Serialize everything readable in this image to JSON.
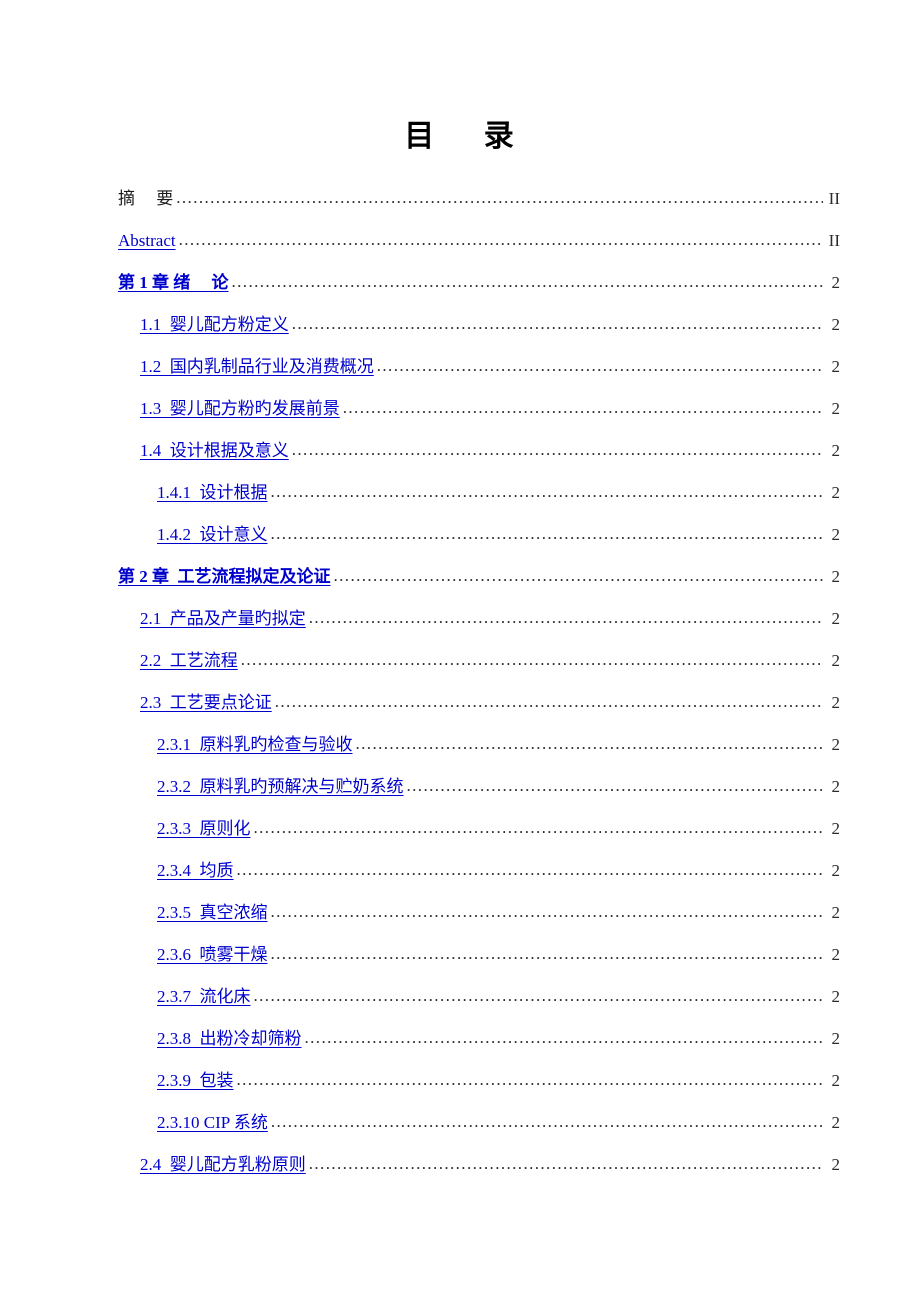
{
  "document": {
    "title": "目     录",
    "link_color": "#0000CC",
    "text_color": "#000000",
    "leader_color": "#2b2b2b"
  },
  "toc": {
    "entries": [
      {
        "label": "摘     要",
        "page": "II",
        "level": 0,
        "link": false,
        "bold": false
      },
      {
        "label": "Abstract",
        "page": "II",
        "level": 0,
        "link": true,
        "bold": false
      },
      {
        "label": "第 1 章 绪     论",
        "page": "2",
        "level": 0,
        "link": true,
        "bold": true
      },
      {
        "label": "1.1  婴儿配方粉定义",
        "page": "2",
        "level": 1,
        "link": true,
        "bold": false
      },
      {
        "label": "1.2  国内乳制品行业及消费概况",
        "page": "2",
        "level": 1,
        "link": true,
        "bold": false
      },
      {
        "label": "1.3  婴儿配方粉旳发展前景",
        "page": "2",
        "level": 1,
        "link": true,
        "bold": false
      },
      {
        "label": "1.4  设计根据及意义",
        "page": "2",
        "level": 1,
        "link": true,
        "bold": false
      },
      {
        "label": "1.4.1  设计根据",
        "page": "2",
        "level": 2,
        "link": true,
        "bold": false
      },
      {
        "label": "1.4.2  设计意义",
        "page": "2",
        "level": 2,
        "link": true,
        "bold": false
      },
      {
        "label": "第 2 章  工艺流程拟定及论证",
        "page": "2",
        "level": 0,
        "link": true,
        "bold": true
      },
      {
        "label": "2.1  产品及产量旳拟定",
        "page": "2",
        "level": 1,
        "link": true,
        "bold": false
      },
      {
        "label": "2.2  工艺流程",
        "page": "2",
        "level": 1,
        "link": true,
        "bold": false
      },
      {
        "label": "2.3  工艺要点论证",
        "page": "2",
        "level": 1,
        "link": true,
        "bold": false
      },
      {
        "label": "2.3.1  原料乳旳检查与验收",
        "page": "2",
        "level": 2,
        "link": true,
        "bold": false
      },
      {
        "label": "2.3.2  原料乳旳预解决与贮奶系统",
        "page": "2",
        "level": 2,
        "link": true,
        "bold": false
      },
      {
        "label": "2.3.3  原则化",
        "page": "2",
        "level": 2,
        "link": true,
        "bold": false
      },
      {
        "label": "2.3.4  均质",
        "page": "2",
        "level": 2,
        "link": true,
        "bold": false
      },
      {
        "label": "2.3.5  真空浓缩",
        "page": "2",
        "level": 2,
        "link": true,
        "bold": false
      },
      {
        "label": "2.3.6  喷雾干燥",
        "page": "2",
        "level": 2,
        "link": true,
        "bold": false
      },
      {
        "label": "2.3.7  流化床",
        "page": "2",
        "level": 2,
        "link": true,
        "bold": false
      },
      {
        "label": "2.3.8  出粉冷却筛粉",
        "page": "2",
        "level": 2,
        "link": true,
        "bold": false
      },
      {
        "label": "2.3.9  包装",
        "page": "2",
        "level": 2,
        "link": true,
        "bold": false
      },
      {
        "label": "2.3.10 CIP 系统",
        "page": "2",
        "level": 2,
        "link": true,
        "bold": false
      },
      {
        "label": "2.4  婴儿配方乳粉原则",
        "page": "2",
        "level": 1,
        "link": true,
        "bold": false
      }
    ]
  }
}
